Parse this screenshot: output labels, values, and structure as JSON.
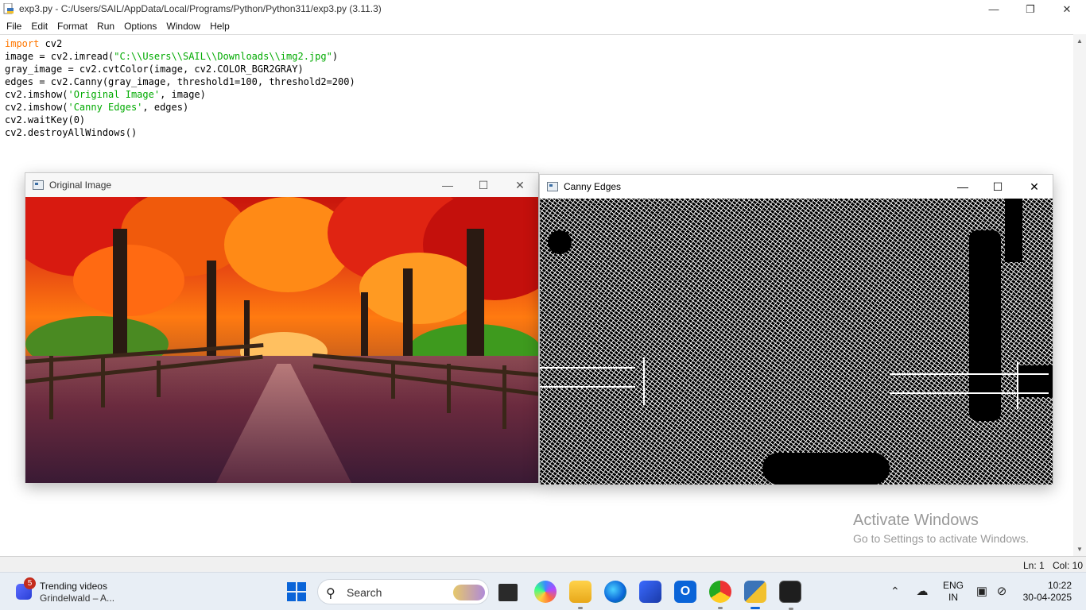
{
  "idle": {
    "title": "exp3.py - C:/Users/SAIL/AppData/Local/Programs/Python/Python311/exp3.py (3.11.3)",
    "menu": [
      "File",
      "Edit",
      "Format",
      "Run",
      "Options",
      "Window",
      "Help"
    ],
    "code": {
      "l1_kw": "import",
      "l1_rest": " cv2",
      "l2_a": "image = cv2.imread(",
      "l2_str": "\"C:\\\\Users\\\\SAIL\\\\Downloads\\\\img2.jpg\"",
      "l2_b": ")",
      "l3": "gray_image = cv2.cvtColor(image, cv2.COLOR_BGR2GRAY)",
      "l4": "edges = cv2.Canny(gray_image, threshold1=100, threshold2=200)",
      "l5_a": "cv2.imshow(",
      "l5_str": "'Original Image'",
      "l5_b": ", image)",
      "l6_a": "cv2.imshow(",
      "l6_str": "'Canny Edges'",
      "l6_b": ", edges)",
      "l7": "cv2.waitKey(0)",
      "l8": "cv2.destroyAllWindows()"
    },
    "status": {
      "line": "Ln: 1",
      "col": "Col: 10"
    }
  },
  "windows": {
    "original": {
      "title": "Original Image"
    },
    "canny": {
      "title": "Canny Edges"
    }
  },
  "activation": {
    "title": "Activate Windows",
    "subtitle": "Go to Settings to activate Windows."
  },
  "taskbar": {
    "widget": {
      "badge": "5",
      "title": "Trending videos",
      "subtitle": "Grindelwald – A..."
    },
    "search_label": "Search",
    "lang": {
      "l1": "ENG",
      "l2": "IN"
    },
    "clock": {
      "time": "10:22",
      "date": "30-04-2025"
    }
  },
  "colors": {
    "keyword": "#ff7700",
    "string": "#00aa00",
    "accent": "#0a64d8"
  }
}
